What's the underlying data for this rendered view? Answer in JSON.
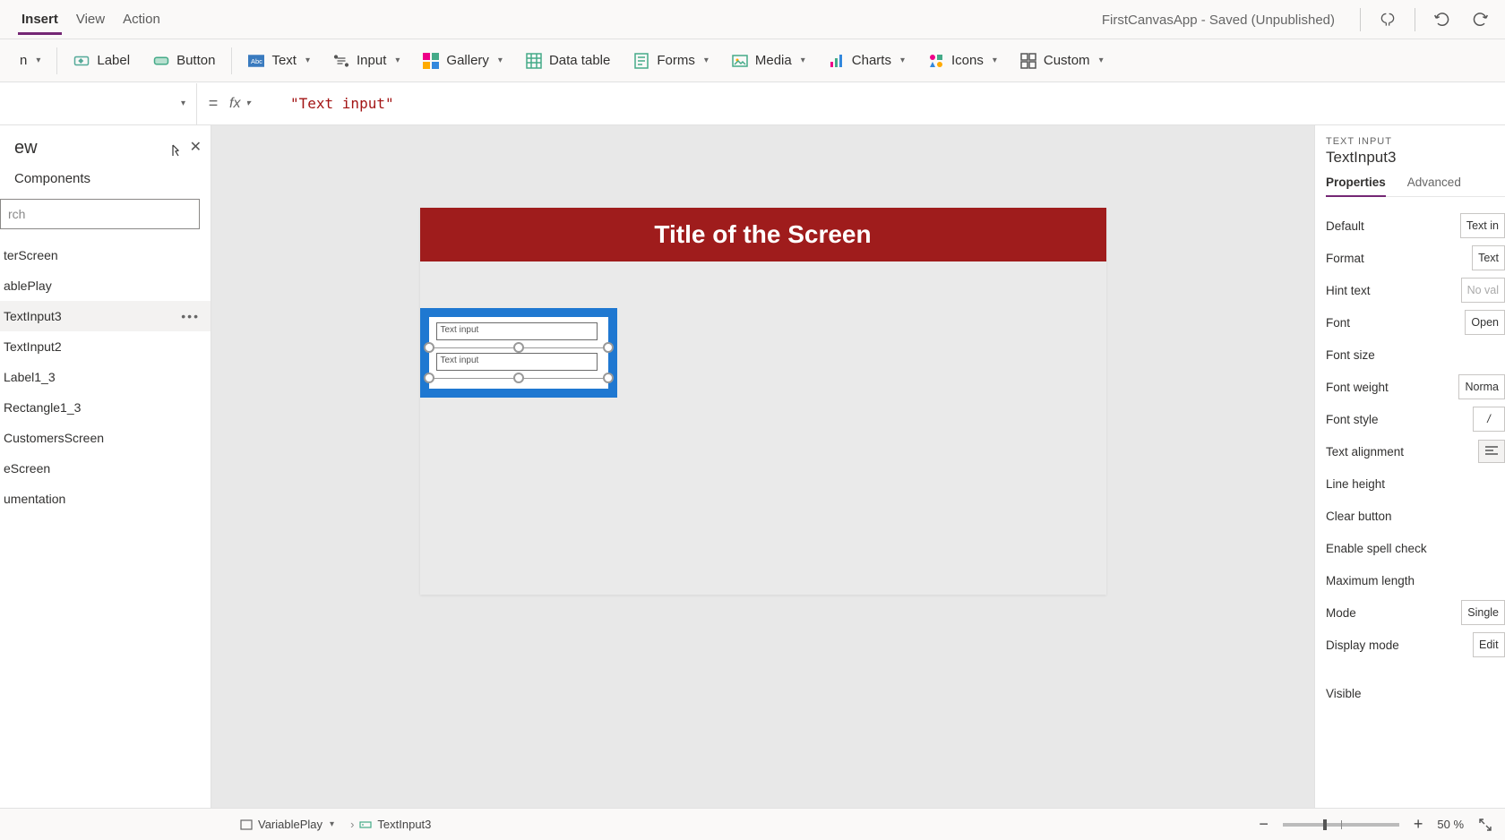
{
  "menu": {
    "items": [
      "Insert",
      "View",
      "Action"
    ],
    "activeIndex": 0,
    "appTitle": "FirstCanvasApp - Saved (Unpublished)"
  },
  "ribbon": {
    "newScreen": "n",
    "label": "Label",
    "button": "Button",
    "text": "Text",
    "input": "Input",
    "gallery": "Gallery",
    "dataTable": "Data table",
    "forms": "Forms",
    "media": "Media",
    "charts": "Charts",
    "icons": "Icons",
    "custom": "Custom"
  },
  "formula": {
    "value": "\"Text input\""
  },
  "leftPanel": {
    "title": "ew",
    "tab": "Components",
    "searchPlaceholder": "rch",
    "items": [
      "terScreen",
      "ablePlay",
      "TextInput3",
      "TextInput2",
      "Label1_3",
      "Rectangle1_3",
      "CustomersScreen",
      "eScreen",
      "umentation"
    ],
    "selectedIndex": 2
  },
  "canvas": {
    "screenTitle": "Title of the Screen",
    "textInputPlaceholder1": "Text input",
    "textInputPlaceholder2": "Text input"
  },
  "rightPanel": {
    "caption": "TEXT INPUT",
    "name": "TextInput3",
    "tabs": [
      "Properties",
      "Advanced"
    ],
    "activeTab": 0,
    "props": {
      "default": {
        "label": "Default",
        "value": "Text in"
      },
      "format": {
        "label": "Format",
        "value": "Text"
      },
      "hintText": {
        "label": "Hint text",
        "value": "No val"
      },
      "font": {
        "label": "Font",
        "value": "Open "
      },
      "fontSize": {
        "label": "Font size",
        "value": ""
      },
      "fontWeight": {
        "label": "Font weight",
        "value": "Norma"
      },
      "fontStyle": {
        "label": "Font style",
        "value": "/"
      },
      "textAlignment": {
        "label": "Text alignment",
        "value": ""
      },
      "lineHeight": {
        "label": "Line height",
        "value": ""
      },
      "clearButton": {
        "label": "Clear button",
        "value": ""
      },
      "spellCheck": {
        "label": "Enable spell check",
        "value": ""
      },
      "maxLength": {
        "label": "Maximum length",
        "value": ""
      },
      "mode": {
        "label": "Mode",
        "value": "Single"
      },
      "displayMode": {
        "label": "Display mode",
        "value": "Edit"
      },
      "visible": {
        "label": "Visible",
        "value": ""
      }
    }
  },
  "statusBar": {
    "breadcrumb1": "VariablePlay",
    "breadcrumb2": "TextInput3",
    "zoomPercent": "50",
    "zoomUnit": "%"
  }
}
